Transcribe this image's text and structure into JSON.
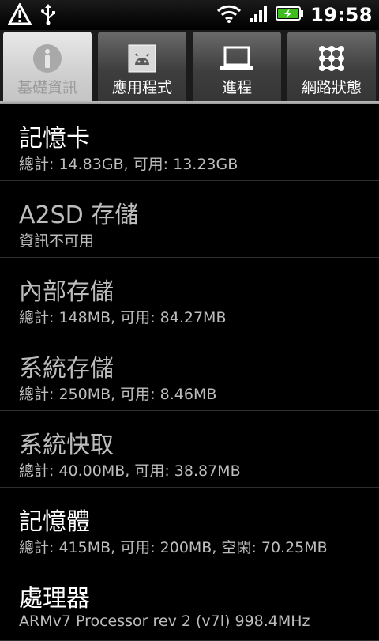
{
  "status_bar": {
    "left_icons": [
      "warning-icon",
      "usb-icon"
    ],
    "right_icons": [
      "wifi-icon",
      "signal-icon",
      "battery-charging-icon"
    ],
    "time": "19:58"
  },
  "tabs": [
    {
      "label": "基礎資訊",
      "icon": "info-icon",
      "active": true
    },
    {
      "label": "應用程式",
      "icon": "android-app-icon",
      "active": false
    },
    {
      "label": "進程",
      "icon": "laptop-icon",
      "active": false
    },
    {
      "label": "網路狀態",
      "icon": "network-grid-icon",
      "active": false
    }
  ],
  "items": [
    {
      "title": "記憶卡",
      "detail": "總計: 14.83GB, 可用: 13.23GB"
    },
    {
      "title": "A2SD 存儲",
      "detail": "資訊不可用"
    },
    {
      "title": "內部存儲",
      "detail": "總計: 148MB, 可用: 84.27MB"
    },
    {
      "title": "系統存儲",
      "detail": "總計: 250MB, 可用: 8.46MB"
    },
    {
      "title": "系統快取",
      "detail": "總計: 40.00MB, 可用: 38.87MB"
    },
    {
      "title": "記憶體",
      "detail": "總計: 415MB, 可用: 200MB, 空閑: 70.25MB"
    },
    {
      "title": "處理器",
      "detail": "ARMv7 Processor rev 2 (v7l)  998.4MHz"
    }
  ],
  "colors": {
    "background": "#000000",
    "tab_active": "#d8d8d8",
    "tab_inactive": "#454545",
    "battery": "#3fbf1f"
  }
}
